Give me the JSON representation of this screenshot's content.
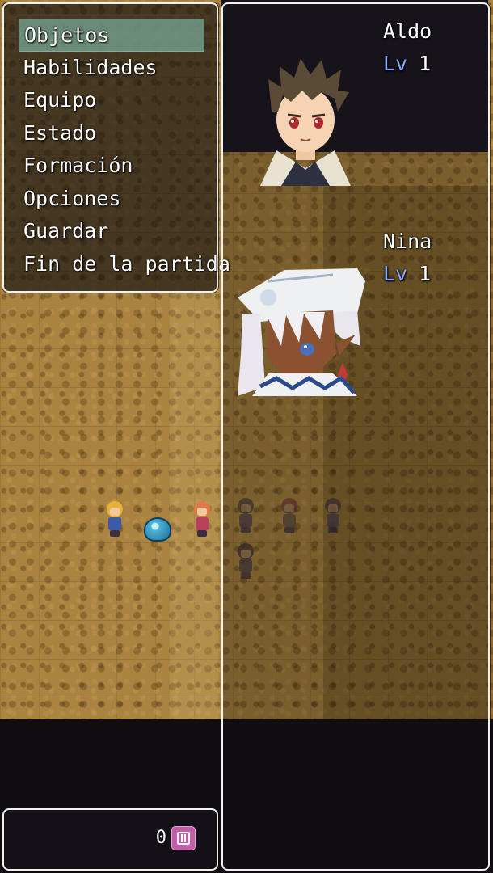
{
  "menu": {
    "items": [
      {
        "label": "Objetos",
        "selected": true
      },
      {
        "label": "Habilidades",
        "selected": false
      },
      {
        "label": "Equipo",
        "selected": false
      },
      {
        "label": "Estado",
        "selected": false
      },
      {
        "label": "Formación",
        "selected": false
      },
      {
        "label": "Opciones",
        "selected": false
      },
      {
        "label": "Guardar",
        "selected": false
      },
      {
        "label": "Fin de la partida",
        "selected": false
      }
    ]
  },
  "party": [
    {
      "name": "Aldo",
      "level_label": "Lv",
      "level": "1",
      "portrait": "aldo-portrait"
    },
    {
      "name": "Nina",
      "level_label": "Lv",
      "level": "1",
      "portrait": "nina-portrait"
    }
  ],
  "gold": {
    "value": "0",
    "icon": "currency-icon"
  },
  "colors": {
    "window_border": "#f2f2f2",
    "selection": "#78aa96",
    "level_label": "#84a9ff",
    "gold_icon": "#c35da8"
  }
}
